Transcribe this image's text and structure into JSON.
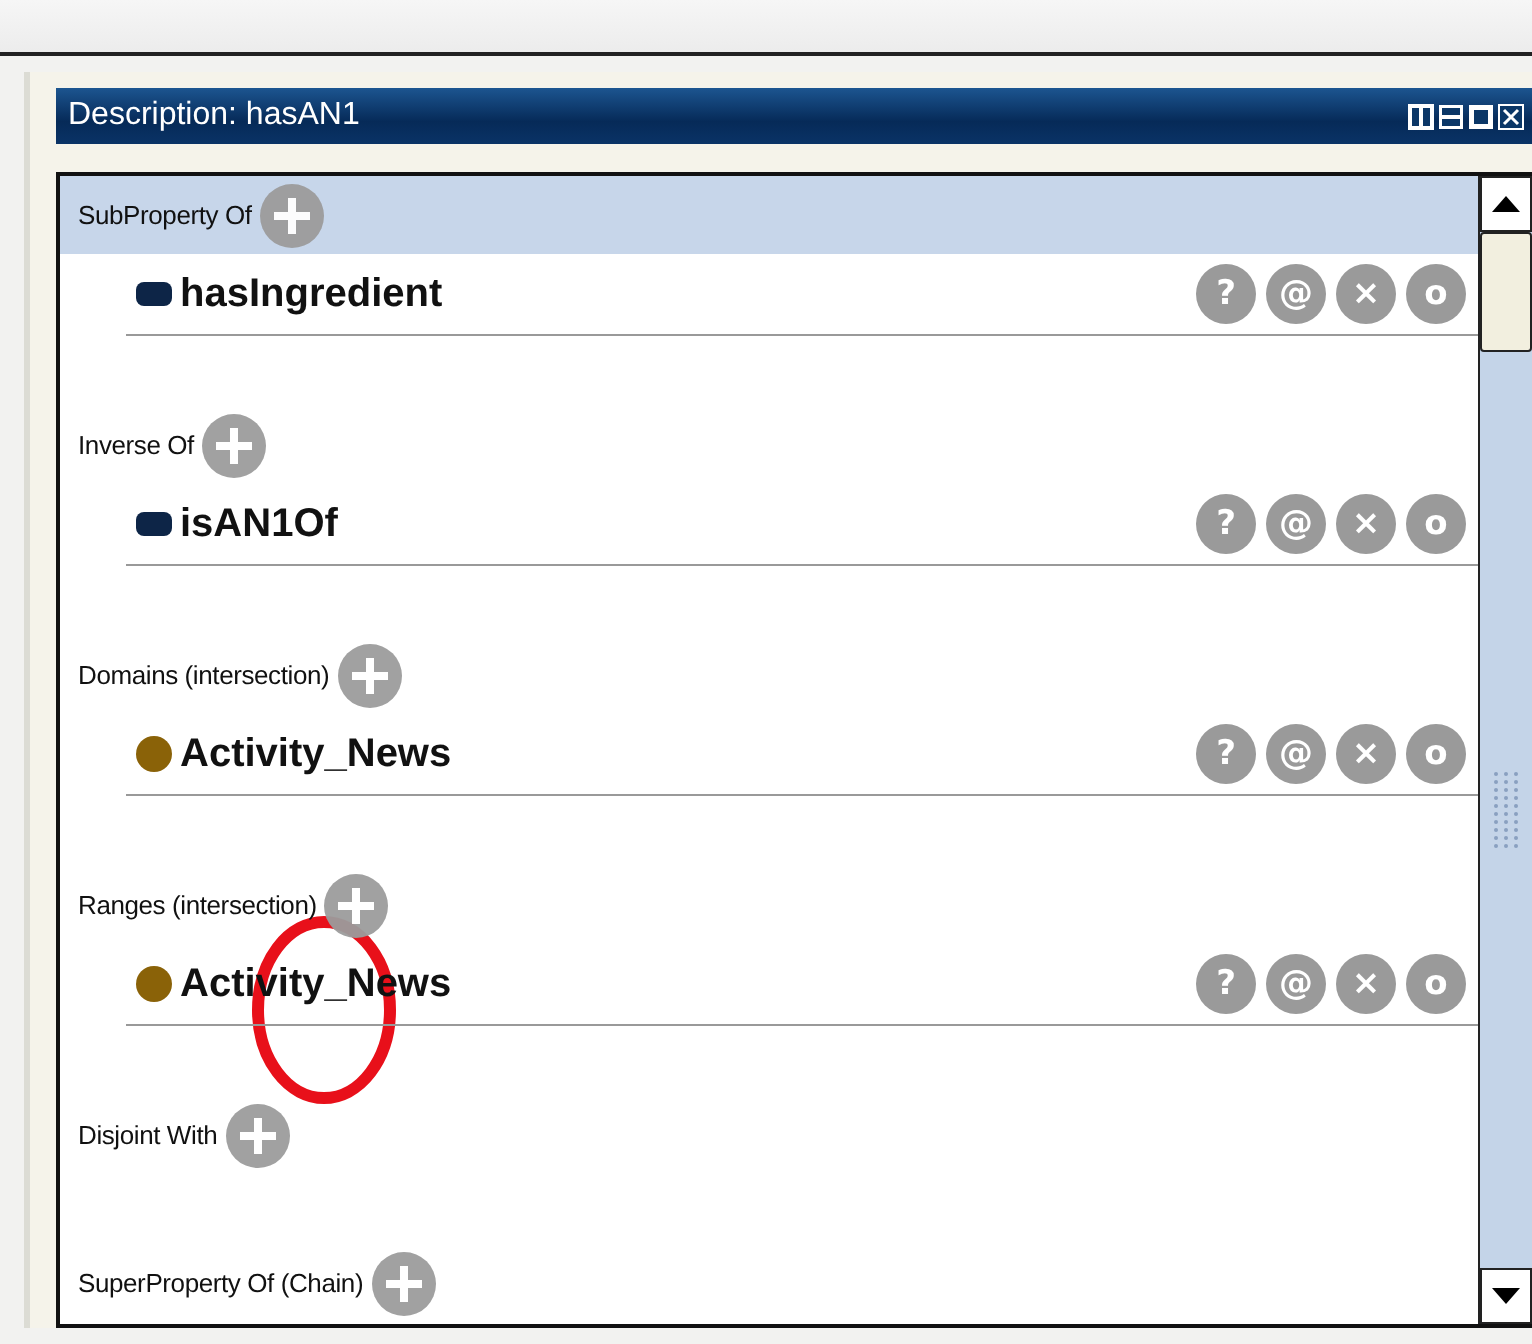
{
  "panel": {
    "title": "Description: hasAN1"
  },
  "sections": [
    {
      "label": "SubProperty Of",
      "selected": true,
      "entries": [
        {
          "kind": "property",
          "name": "hasIngredient",
          "actions": [
            "?",
            "@",
            "×",
            "o"
          ]
        }
      ]
    },
    {
      "label": "Inverse Of",
      "selected": false,
      "entries": [
        {
          "kind": "property",
          "name": "isAN1Of",
          "actions": [
            "?",
            "@",
            "×",
            "o"
          ]
        }
      ]
    },
    {
      "label": "Domains (intersection)",
      "selected": false,
      "entries": [
        {
          "kind": "class",
          "name": "Activity_News",
          "actions": [
            "?",
            "@",
            "×",
            "o"
          ]
        }
      ]
    },
    {
      "label": "Ranges (intersection)",
      "selected": false,
      "annotated": true,
      "entries": [
        {
          "kind": "class",
          "name": "Activity_News",
          "actions": [
            "?",
            "@",
            "×",
            "o"
          ]
        }
      ]
    },
    {
      "label": "Disjoint With",
      "selected": false
    },
    {
      "label": "SuperProperty Of (Chain)",
      "selected": false
    }
  ]
}
